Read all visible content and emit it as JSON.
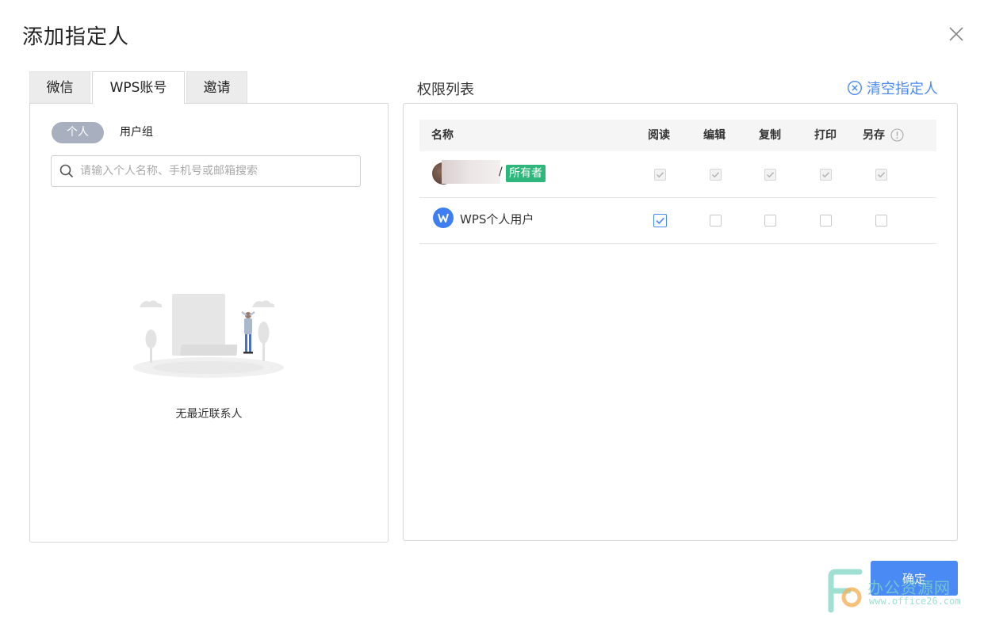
{
  "dialog": {
    "title": "添加指定人",
    "confirm_label": "确定"
  },
  "left": {
    "tabs": [
      {
        "label": "微信"
      },
      {
        "label": "WPS账号"
      },
      {
        "label": "邀请"
      }
    ],
    "active_tab": "WPS账号",
    "segment": {
      "personal": "个人",
      "group": "用户组",
      "selected": "个人"
    },
    "search": {
      "placeholder": "请输入个人名称、手机号或邮箱搜索",
      "value": ""
    },
    "empty_text": "无最近联系人"
  },
  "right": {
    "title": "权限列表",
    "clear_label": "清空指定人",
    "columns": [
      "名称",
      "阅读",
      "编辑",
      "复制",
      "打印",
      "另存"
    ],
    "rows": [
      {
        "name": "",
        "separator": "/",
        "badge": "所有者",
        "permissions": [
          true,
          true,
          true,
          true,
          true
        ],
        "disabled": true
      },
      {
        "name": "WPS个人用户",
        "permissions": [
          true,
          false,
          false,
          false,
          false
        ],
        "disabled": false
      }
    ]
  },
  "watermark": {
    "text": "办公资源网",
    "url": "www.office26.com"
  },
  "colors": {
    "accent": "#4a8af4",
    "owner_badge": "#2fb67c",
    "pill": "#a8b0c0"
  }
}
